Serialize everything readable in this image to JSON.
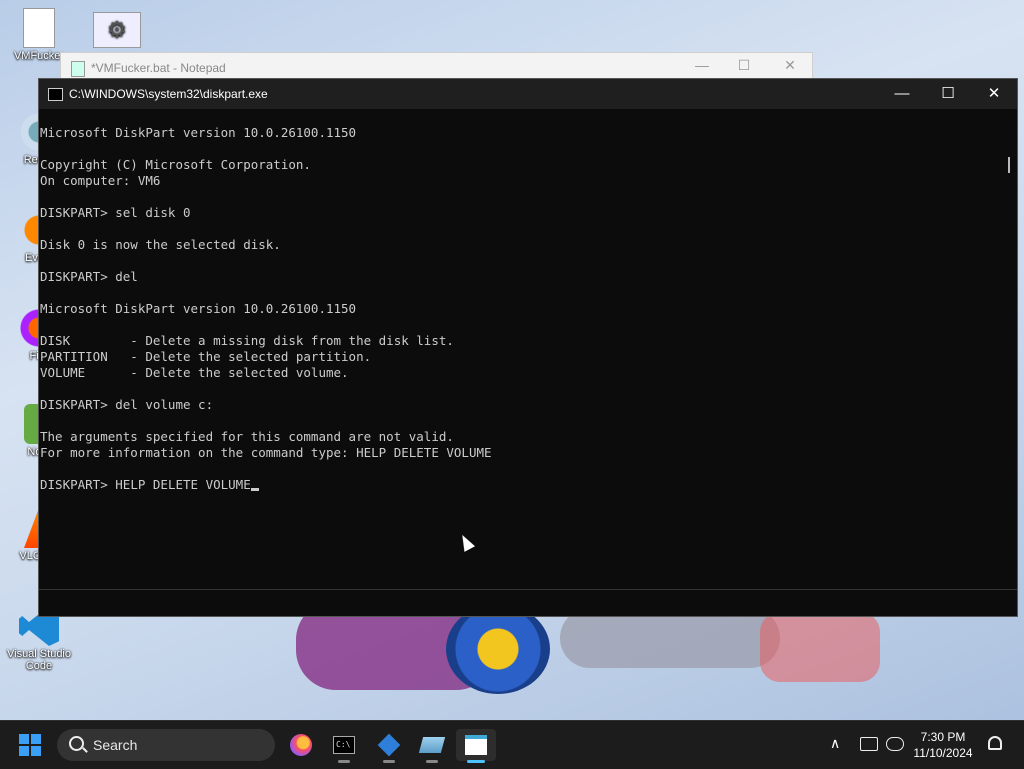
{
  "desktop": {
    "icons": [
      {
        "label": "VMFucker",
        "icon": "batch-file-icon"
      },
      {
        "label": "",
        "icon": "settings-file-icon"
      },
      {
        "label": "Recyc",
        "icon": "recycle-bin-icon"
      },
      {
        "label": "Every",
        "icon": "everything-search-icon"
      },
      {
        "label": "Fire",
        "icon": "firefox-icon"
      },
      {
        "label": "Note",
        "icon": "notepadpp-icon"
      },
      {
        "label": "VLC pla",
        "icon": "vlc-icon"
      },
      {
        "label": "Visual Studio Code",
        "icon": "vscode-icon"
      }
    ]
  },
  "notepad": {
    "title": "*VMFucker.bat - Notepad",
    "minimize": "—",
    "maximize": "☐",
    "close": "✕"
  },
  "console": {
    "title": "C:\\WINDOWS\\system32\\diskpart.exe",
    "minimize": "—",
    "maximize": "☐",
    "close": "✕",
    "output": "Microsoft DiskPart version 10.0.26100.1150\n\nCopyright (C) Microsoft Corporation.\nOn computer: VM6\n\nDISKPART> sel disk 0\n\nDisk 0 is now the selected disk.\n\nDISKPART> del\n\nMicrosoft DiskPart version 10.0.26100.1150\n\nDISK        - Delete a missing disk from the disk list.\nPARTITION   - Delete the selected partition.\nVOLUME      - Delete the selected volume.\n\nDISKPART> del volume c:\n\nThe arguments specified for this command are not valid.\nFor more information on the command type: HELP DELETE VOLUME\n\n",
    "prompt": "DISKPART> ",
    "current_input": "HELP DELETE VOLUME"
  },
  "taskbar": {
    "search_label": "Search",
    "apps": [
      {
        "name": "firefox",
        "active": false
      },
      {
        "name": "command-prompt",
        "active": false
      },
      {
        "name": "app-cube",
        "active": false
      },
      {
        "name": "app-notepad-blue",
        "active": false
      },
      {
        "name": "notepad",
        "active": true
      }
    ],
    "tray_chevron": "∧",
    "time": "7:30 PM",
    "date": "11/10/2024"
  }
}
